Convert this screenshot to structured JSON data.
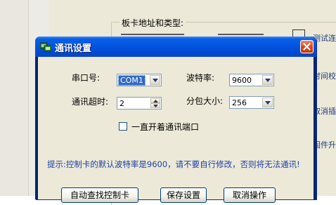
{
  "background": {
    "group_title": "板卡地址和类型:",
    "side_texts": [
      "测试连",
      "时间校",
      "取消插",
      "固件升"
    ]
  },
  "dialog": {
    "title": "通讯设置",
    "icons": {
      "title": "network-settings-icon",
      "close": "close-icon"
    },
    "fields": {
      "serial_port": {
        "label": "串口号:",
        "value": "COM1"
      },
      "baud_rate": {
        "label": "波特率:",
        "value": "9600"
      },
      "timeout": {
        "label": "通讯超时:",
        "value": "2"
      },
      "packet_size": {
        "label": "分包大小:",
        "value": "256"
      }
    },
    "keep_open": {
      "label": "一直开着通讯端口",
      "checked": false
    },
    "hint": "提示:控制卡的默认波特率是9600，请不要自行修改，否则将无法通讯!",
    "buttons": {
      "auto_find": "自动查找控制卡",
      "save": "保存设置",
      "cancel": "取消操作"
    }
  }
}
